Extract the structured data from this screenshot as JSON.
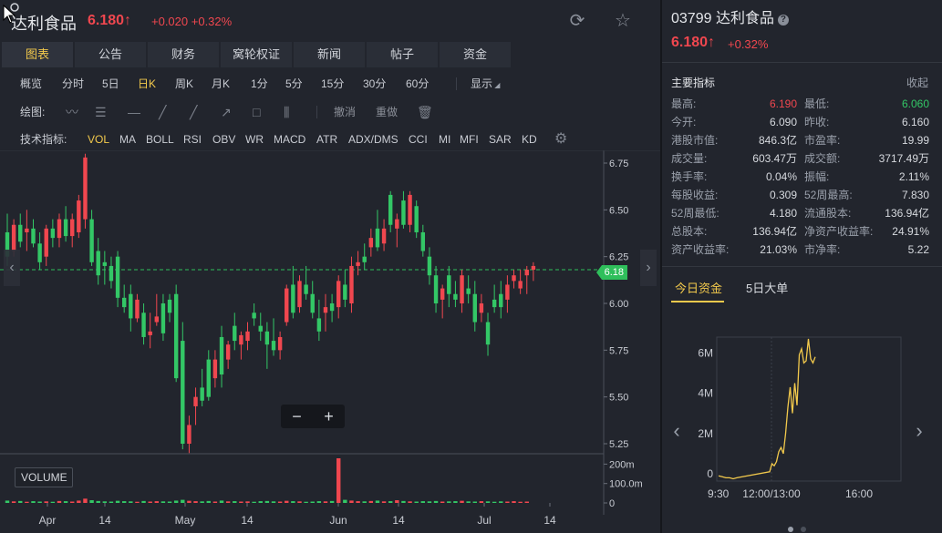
{
  "header": {
    "name": "达利食品",
    "price": "6.180",
    "arrow": "↑",
    "change": "+0.020",
    "change_pct": "+0.32%"
  },
  "tabs": [
    "图表",
    "公告",
    "财务",
    "窝轮权证",
    "新闻",
    "帖子",
    "资金"
  ],
  "periods": [
    "概览",
    "分时",
    "5日",
    "日K",
    "周K",
    "月K",
    "1分",
    "5分",
    "15分",
    "30分",
    "60分",
    "显示"
  ],
  "draw": {
    "label": "绘图:",
    "undo": "撤消",
    "redo": "重做"
  },
  "indicators": {
    "label": "技术指标:",
    "items": [
      "VOL",
      "MA",
      "BOLL",
      "RSI",
      "OBV",
      "WR",
      "MACD",
      "ATR",
      "ADX/DMS",
      "CCI",
      "MI",
      "MFI",
      "SAR",
      "KD"
    ]
  },
  "chart": {
    "price_ticks": [
      "6.75",
      "6.50",
      "6.25",
      "6.00",
      "5.75",
      "5.50",
      "5.25"
    ],
    "vol_ticks": [
      "200m",
      "100.0m",
      "0"
    ],
    "x_labels": [
      "Apr",
      "14",
      "May",
      "14",
      "Jun",
      "14",
      "Jul",
      "14"
    ],
    "last_price_tag": "6.18",
    "volume_label": "VOLUME",
    "zoom_out": "−",
    "zoom_in": "+"
  },
  "chart_data": {
    "type": "candlestick",
    "title": "",
    "y_range": [
      5.2,
      6.8
    ],
    "last_price": 6.18,
    "candles": [
      {
        "o": 6.38,
        "h": 6.48,
        "l": 6.2,
        "c": 6.25
      },
      {
        "o": 6.28,
        "h": 6.45,
        "l": 6.25,
        "c": 6.42
      },
      {
        "o": 6.42,
        "h": 6.48,
        "l": 6.3,
        "c": 6.33
      },
      {
        "o": 6.38,
        "h": 6.5,
        "l": 6.28,
        "c": 6.4
      },
      {
        "o": 6.4,
        "h": 6.45,
        "l": 6.3,
        "c": 6.32
      },
      {
        "o": 6.32,
        "h": 6.38,
        "l": 6.18,
        "c": 6.22
      },
      {
        "o": 6.25,
        "h": 6.42,
        "l": 6.2,
        "c": 6.4
      },
      {
        "o": 6.4,
        "h": 6.45,
        "l": 6.3,
        "c": 6.35
      },
      {
        "o": 6.35,
        "h": 6.48,
        "l": 6.3,
        "c": 6.45
      },
      {
        "o": 6.45,
        "h": 6.52,
        "l": 6.33,
        "c": 6.36
      },
      {
        "o": 6.36,
        "h": 6.48,
        "l": 6.3,
        "c": 6.45
      },
      {
        "o": 6.38,
        "h": 6.58,
        "l": 6.35,
        "c": 6.55
      },
      {
        "o": 6.45,
        "h": 6.8,
        "l": 6.4,
        "c": 6.78
      },
      {
        "o": 6.45,
        "h": 6.5,
        "l": 6.2,
        "c": 6.22
      },
      {
        "o": 6.28,
        "h": 6.35,
        "l": 6.1,
        "c": 6.15
      },
      {
        "o": 6.22,
        "h": 6.28,
        "l": 6.1,
        "c": 6.2
      },
      {
        "o": 6.2,
        "h": 6.25,
        "l": 6.08,
        "c": 6.12
      },
      {
        "o": 6.25,
        "h": 6.28,
        "l": 5.98,
        "c": 6.03
      },
      {
        "o": 6.03,
        "h": 6.1,
        "l": 5.95,
        "c": 5.98
      },
      {
        "o": 6.05,
        "h": 6.1,
        "l": 5.85,
        "c": 5.92
      },
      {
        "o": 5.92,
        "h": 6.05,
        "l": 5.9,
        "c": 6.02
      },
      {
        "o": 5.95,
        "h": 6.0,
        "l": 5.78,
        "c": 5.82
      },
      {
        "o": 5.83,
        "h": 5.95,
        "l": 5.76,
        "c": 5.85
      },
      {
        "o": 5.9,
        "h": 6.05,
        "l": 5.88,
        "c": 5.93
      },
      {
        "o": 6.0,
        "h": 6.05,
        "l": 5.8,
        "c": 5.84
      },
      {
        "o": 6.02,
        "h": 6.05,
        "l": 5.9,
        "c": 5.95
      },
      {
        "o": 6.05,
        "h": 6.1,
        "l": 5.58,
        "c": 5.6
      },
      {
        "o": 5.8,
        "h": 5.9,
        "l": 5.22,
        "c": 5.25
      },
      {
        "o": 5.25,
        "h": 5.4,
        "l": 5.2,
        "c": 5.35
      },
      {
        "o": 5.45,
        "h": 5.55,
        "l": 5.35,
        "c": 5.5
      },
      {
        "o": 5.55,
        "h": 5.65,
        "l": 5.45,
        "c": 5.48
      },
      {
        "o": 5.7,
        "h": 5.75,
        "l": 5.48,
        "c": 5.5
      },
      {
        "o": 5.6,
        "h": 5.75,
        "l": 5.55,
        "c": 5.7
      },
      {
        "o": 5.82,
        "h": 5.88,
        "l": 5.55,
        "c": 5.62
      },
      {
        "o": 5.7,
        "h": 5.8,
        "l": 5.65,
        "c": 5.78
      },
      {
        "o": 5.88,
        "h": 5.95,
        "l": 5.75,
        "c": 5.8
      },
      {
        "o": 5.78,
        "h": 5.85,
        "l": 5.7,
        "c": 5.83
      },
      {
        "o": 5.8,
        "h": 5.9,
        "l": 5.75,
        "c": 5.85
      },
      {
        "o": 5.95,
        "h": 6.0,
        "l": 5.88,
        "c": 5.92
      },
      {
        "o": 5.88,
        "h": 5.95,
        "l": 5.8,
        "c": 5.85
      },
      {
        "o": 5.85,
        "h": 5.9,
        "l": 5.65,
        "c": 5.78
      },
      {
        "o": 5.8,
        "h": 5.92,
        "l": 5.72,
        "c": 5.75
      },
      {
        "o": 5.75,
        "h": 5.85,
        "l": 5.7,
        "c": 5.82
      },
      {
        "o": 5.9,
        "h": 6.1,
        "l": 5.88,
        "c": 6.08
      },
      {
        "o": 6.1,
        "h": 6.2,
        "l": 5.92,
        "c": 5.95
      },
      {
        "o": 5.98,
        "h": 6.15,
        "l": 5.95,
        "c": 6.12
      },
      {
        "o": 6.1,
        "h": 6.2,
        "l": 6.02,
        "c": 6.05
      },
      {
        "o": 6.05,
        "h": 6.12,
        "l": 5.92,
        "c": 5.95
      },
      {
        "o": 5.92,
        "h": 6.02,
        "l": 5.8,
        "c": 5.85
      },
      {
        "o": 5.95,
        "h": 6.05,
        "l": 5.85,
        "c": 5.98
      },
      {
        "o": 6.0,
        "h": 6.05,
        "l": 5.9,
        "c": 5.96
      },
      {
        "o": 5.98,
        "h": 6.15,
        "l": 5.92,
        "c": 6.12
      },
      {
        "o": 6.1,
        "h": 6.18,
        "l": 5.98,
        "c": 6.02
      },
      {
        "o": 6.0,
        "h": 6.25,
        "l": 5.95,
        "c": 6.2
      },
      {
        "o": 6.2,
        "h": 6.28,
        "l": 6.15,
        "c": 6.22
      },
      {
        "o": 6.25,
        "h": 6.32,
        "l": 6.18,
        "c": 6.22
      },
      {
        "o": 6.3,
        "h": 6.4,
        "l": 6.25,
        "c": 6.35
      },
      {
        "o": 6.4,
        "h": 6.5,
        "l": 6.28,
        "c": 6.3
      },
      {
        "o": 6.32,
        "h": 6.45,
        "l": 6.28,
        "c": 6.4
      },
      {
        "o": 6.58,
        "h": 6.6,
        "l": 6.38,
        "c": 6.42
      },
      {
        "o": 6.4,
        "h": 6.48,
        "l": 6.3,
        "c": 6.45
      },
      {
        "o": 6.55,
        "h": 6.6,
        "l": 6.4,
        "c": 6.42
      },
      {
        "o": 6.42,
        "h": 6.6,
        "l": 6.38,
        "c": 6.58
      },
      {
        "o": 6.52,
        "h": 6.55,
        "l": 6.35,
        "c": 6.38
      },
      {
        "o": 6.38,
        "h": 6.42,
        "l": 6.25,
        "c": 6.28
      },
      {
        "o": 6.25,
        "h": 6.3,
        "l": 6.1,
        "c": 6.15
      },
      {
        "o": 6.15,
        "h": 6.2,
        "l": 5.95,
        "c": 6.0
      },
      {
        "o": 6.02,
        "h": 6.1,
        "l": 5.92,
        "c": 6.08
      },
      {
        "o": 6.15,
        "h": 6.2,
        "l": 5.98,
        "c": 6.05
      },
      {
        "o": 6.05,
        "h": 6.12,
        "l": 5.98,
        "c": 6.02
      },
      {
        "o": 6.0,
        "h": 6.18,
        "l": 5.95,
        "c": 6.15
      },
      {
        "o": 6.08,
        "h": 6.15,
        "l": 6.0,
        "c": 6.05
      },
      {
        "o": 6.05,
        "h": 6.12,
        "l": 5.85,
        "c": 5.9
      },
      {
        "o": 5.95,
        "h": 6.05,
        "l": 5.9,
        "c": 6.0
      },
      {
        "o": 5.9,
        "h": 5.95,
        "l": 5.72,
        "c": 5.78
      },
      {
        "o": 6.02,
        "h": 6.1,
        "l": 5.95,
        "c": 5.98
      },
      {
        "o": 6.05,
        "h": 6.12,
        "l": 5.92,
        "c": 5.98
      },
      {
        "o": 6.02,
        "h": 6.15,
        "l": 5.95,
        "c": 6.1
      },
      {
        "o": 6.12,
        "h": 6.18,
        "l": 6.08,
        "c": 6.15
      },
      {
        "o": 6.08,
        "h": 6.18,
        "l": 6.05,
        "c": 6.12
      },
      {
        "o": 6.15,
        "h": 6.2,
        "l": 6.05,
        "c": 6.18
      },
      {
        "o": 6.18,
        "h": 6.22,
        "l": 6.12,
        "c": 6.2
      }
    ],
    "volumes": [
      12,
      8,
      10,
      6,
      9,
      7,
      8,
      6,
      10,
      9,
      7,
      12,
      22,
      14,
      10,
      8,
      7,
      11,
      9,
      8,
      6,
      10,
      7,
      9,
      8,
      7,
      12,
      16,
      11,
      9,
      8,
      10,
      7,
      12,
      8,
      9,
      7,
      8,
      6,
      9,
      10,
      8,
      7,
      11,
      9,
      8,
      6,
      7,
      9,
      8,
      10,
      230,
      16,
      12,
      9,
      8,
      10,
      12,
      8,
      9,
      14,
      10,
      8,
      7,
      9,
      8,
      10,
      7,
      8,
      9,
      11,
      8,
      7,
      9,
      8,
      6,
      8,
      7,
      9,
      6,
      7
    ]
  },
  "right": {
    "code": "03799 达利食品",
    "help": "?",
    "price": "6.180",
    "arrow": "↑",
    "change_pct": "+0.32%",
    "section": "主要指标",
    "collapse": "收起",
    "stats": [
      [
        "最高:",
        "6.190",
        "最低:",
        "6.060"
      ],
      [
        "今开:",
        "6.090",
        "昨收:",
        "6.160"
      ],
      [
        "港股市值:",
        "846.3亿",
        "市盈率:",
        "19.99"
      ],
      [
        "成交量:",
        "603.47万",
        "成交额:",
        "3717.49万"
      ],
      [
        "换手率:",
        "0.04%",
        "振幅:",
        "2.11%"
      ],
      [
        "每股收益:",
        "0.309",
        "52周最高:",
        "7.830"
      ],
      [
        "52周最低:",
        "4.180",
        "流通股本:",
        "136.94亿"
      ],
      [
        "总股本:",
        "136.94亿",
        "净资产收益率:",
        "24.91%"
      ],
      [
        "资产收益率:",
        "21.03%",
        "市净率:",
        "5.22"
      ]
    ],
    "fund_tabs": [
      "今日资金",
      "5日大单"
    ],
    "fund_chart": {
      "y_ticks": [
        "6M",
        "4M",
        "2M",
        "0"
      ],
      "x_ticks": [
        "9:30",
        "12:00/13:00",
        "16:00"
      ]
    }
  },
  "fund_chart_data": {
    "type": "line",
    "title": "",
    "ylim": [
      -0.3,
      6.5
    ],
    "series": [
      {
        "values": [
          -0.1,
          -0.15,
          -0.2,
          -0.2,
          -0.25,
          -0.2,
          0.1,
          0.5,
          0.4,
          0.6,
          1.1,
          1.3,
          1.0,
          2.0,
          3.3,
          4.3,
          3.0,
          4.5,
          3.4,
          5.9,
          6.2,
          5.5,
          5.6,
          6.8,
          5.7,
          5.5,
          5.8
        ]
      }
    ]
  },
  "colors": {
    "up": "#f0474f",
    "down": "#33c766",
    "accent": "#f2c94c"
  }
}
